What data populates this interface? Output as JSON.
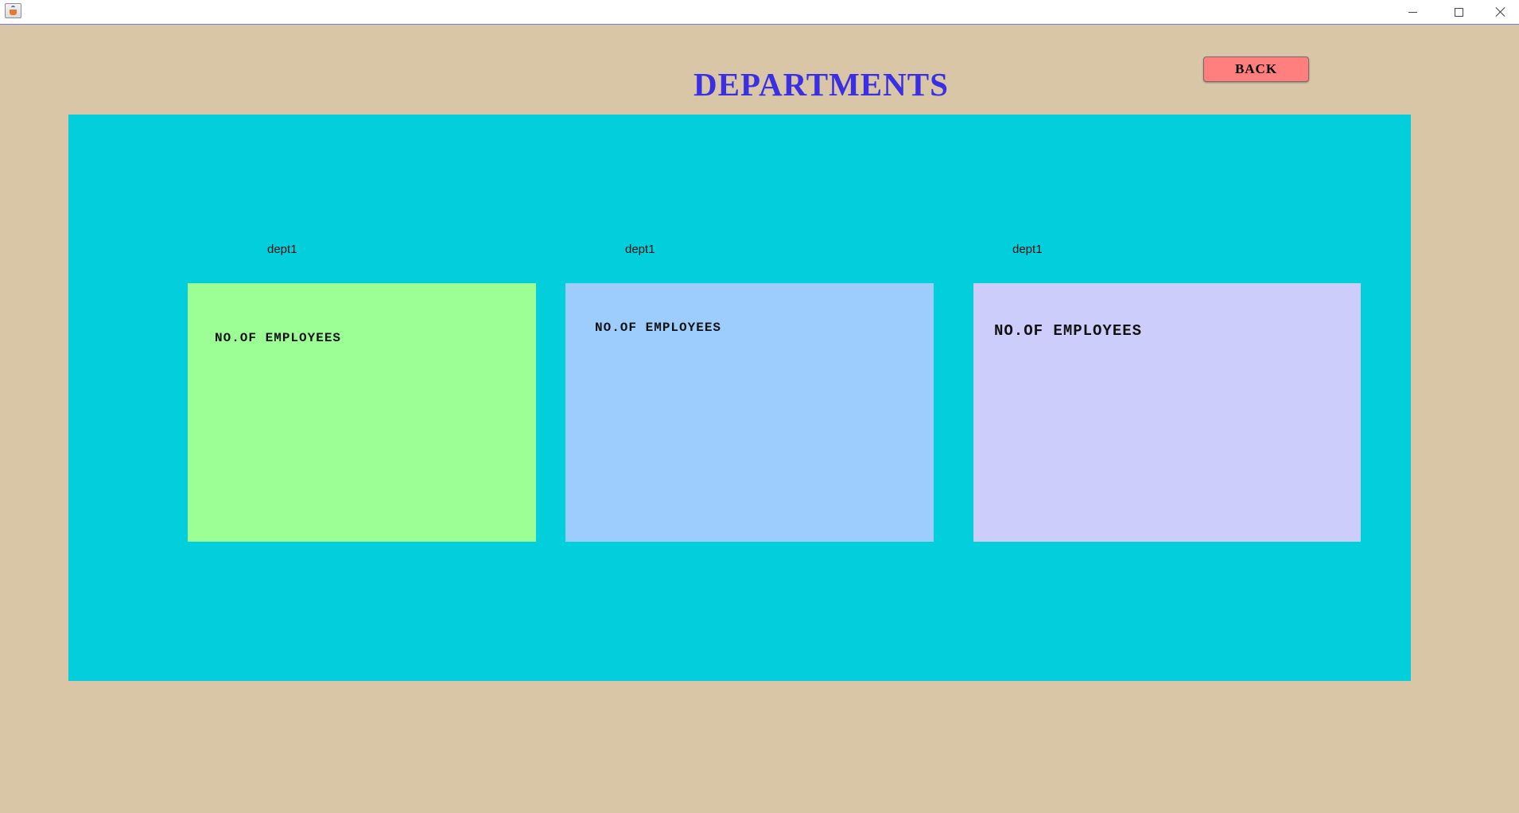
{
  "window": {
    "minimize_icon": "minimize-icon",
    "maximize_icon": "maximize-icon",
    "close_icon": "close-icon",
    "app_icon": "java-app-icon"
  },
  "header": {
    "title": "DEPARTMENTS",
    "back_label": "BACK"
  },
  "departments": [
    {
      "name": "dept1",
      "label": "NO.OF EMPLOYEES",
      "color": "#9cff96"
    },
    {
      "name": "dept1",
      "label": "NO.OF EMPLOYEES",
      "color": "#9dcdfc"
    },
    {
      "name": "dept1",
      "label": "NO.OF EMPLOYEES",
      "color": "#cdcdfb"
    }
  ],
  "colors": {
    "background": "#d8c6a6",
    "panel": "#03cedb",
    "title": "#3a2fe3",
    "back_button": "#ff7f7f"
  }
}
